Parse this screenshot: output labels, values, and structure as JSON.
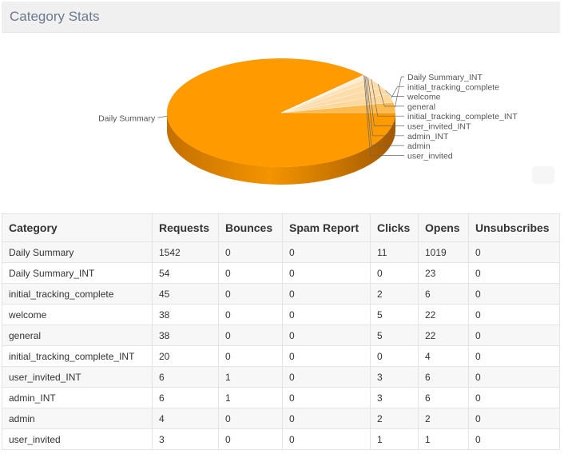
{
  "page": {
    "title": "Category Stats"
  },
  "colors": {
    "pie_top": "#ff9a00",
    "pie_side": "#e08100",
    "pie_side_dark": "#a85d00",
    "label_line": "#666666"
  },
  "chart_data": {
    "type": "pie",
    "title": "",
    "slices": [
      {
        "label": "Daily Summary",
        "value": 1542
      },
      {
        "label": "Daily Summary_INT",
        "value": 54
      },
      {
        "label": "initial_tracking_complete",
        "value": 45
      },
      {
        "label": "welcome",
        "value": 38
      },
      {
        "label": "general",
        "value": 38
      },
      {
        "label": "initial_tracking_complete_INT",
        "value": 20
      },
      {
        "label": "user_invited_INT",
        "value": 6
      },
      {
        "label": "admin_INT",
        "value": 6
      },
      {
        "label": "admin",
        "value": 4
      },
      {
        "label": "user_invited",
        "value": 3
      }
    ]
  },
  "table": {
    "headers": [
      "Category",
      "Requests",
      "Bounces",
      "Spam Report",
      "Clicks",
      "Opens",
      "Unsubscribes"
    ],
    "rows": [
      [
        "Daily Summary",
        "1542",
        "0",
        "0",
        "11",
        "1019",
        "0"
      ],
      [
        "Daily Summary_INT",
        "54",
        "0",
        "0",
        "0",
        "23",
        "0"
      ],
      [
        "initial_tracking_complete",
        "45",
        "0",
        "0",
        "2",
        "6",
        "0"
      ],
      [
        "welcome",
        "38",
        "0",
        "0",
        "5",
        "22",
        "0"
      ],
      [
        "general",
        "38",
        "0",
        "0",
        "5",
        "22",
        "0"
      ],
      [
        "initial_tracking_complete_INT",
        "20",
        "0",
        "0",
        "0",
        "4",
        "0"
      ],
      [
        "user_invited_INT",
        "6",
        "1",
        "0",
        "3",
        "6",
        "0"
      ],
      [
        "admin_INT",
        "6",
        "1",
        "0",
        "3",
        "6",
        "0"
      ],
      [
        "admin",
        "4",
        "0",
        "0",
        "2",
        "2",
        "0"
      ],
      [
        "user_invited",
        "3",
        "0",
        "0",
        "1",
        "1",
        "0"
      ]
    ]
  }
}
